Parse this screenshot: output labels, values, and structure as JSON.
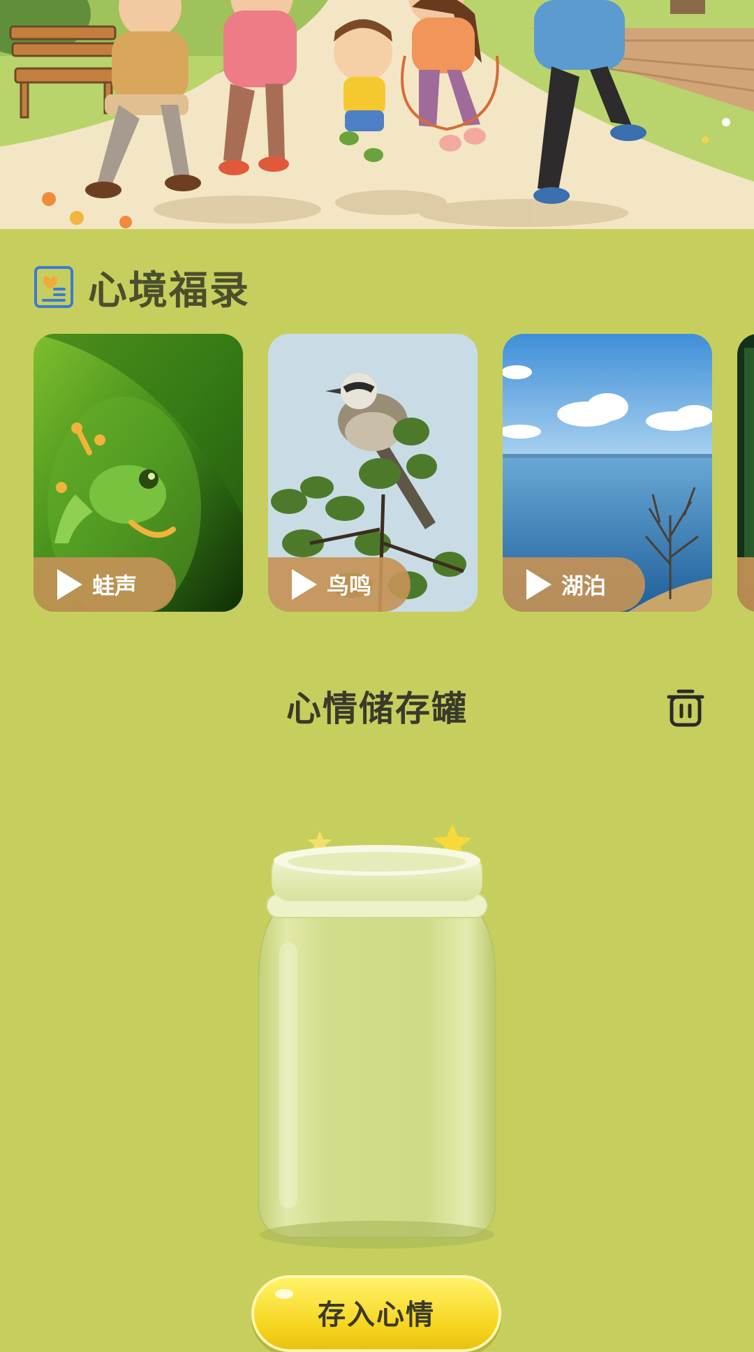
{
  "hero": {
    "image": "family-exercising-in-park-illustration"
  },
  "section": {
    "title": "心境福录",
    "icon": "note-book-icon"
  },
  "sounds": [
    {
      "label": "蛙声",
      "image": "frog-photo",
      "icon": "play-icon"
    },
    {
      "label": "鸟鸣",
      "image": "bird-photo",
      "icon": "play-icon"
    },
    {
      "label": "湖泊",
      "image": "lake-photo",
      "icon": "play-icon"
    }
  ],
  "jar": {
    "title": "心情储存罐",
    "delete_icon": "trash-icon",
    "image": "glass-jar"
  },
  "save_button": {
    "label": "存入心情"
  },
  "colors": {
    "background": "#c6cf5e",
    "pill": "#c49356",
    "button": "#f6d41c",
    "accent_icon": "#3a7bd5"
  }
}
